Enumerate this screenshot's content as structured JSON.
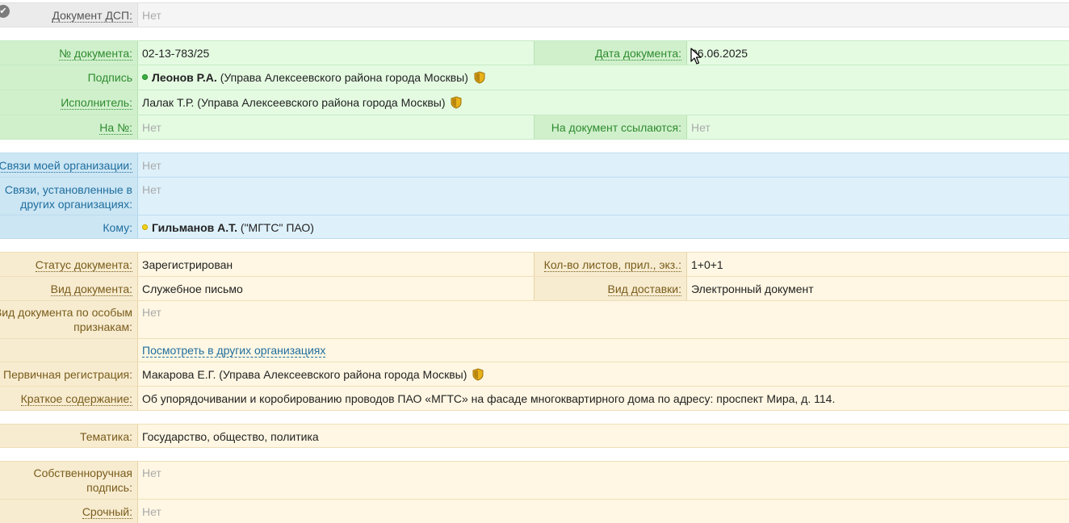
{
  "dsp": {
    "label": "Документ ДСП:",
    "value": "Нет"
  },
  "doc_number": {
    "label": "№ документа:",
    "value": "02-13-783/25"
  },
  "doc_date": {
    "label": "Дата документа:",
    "value": "06.06.2025"
  },
  "signature": {
    "label": "Подпись",
    "name": "Леонов Р.А.",
    "org": "(Управа Алексеевского района города Москвы)"
  },
  "executor": {
    "label": "Исполнитель:",
    "value": "Лалак Т.Р. (Управа Алексеевского района города Москвы)"
  },
  "in_reply": {
    "label": "На №:",
    "value": "Нет"
  },
  "referenced_by": {
    "label": "На документ ссылаются:",
    "value": "Нет"
  },
  "my_org_links": {
    "label": "Связи моей организации:",
    "value": "Нет"
  },
  "other_org_links": {
    "label_line1": "Связи, установленные в",
    "label_line2": "других организациях:",
    "value": "Нет"
  },
  "recipient": {
    "label": "Кому:",
    "name": "Гильманов А.Т.",
    "org": "(\"МГТС\" ПАО)"
  },
  "status": {
    "label": "Статус документа:",
    "value": "Зарегистрирован"
  },
  "sheets": {
    "label": "Кол-во листов, прил., экз.:",
    "value": "1+0+1"
  },
  "doc_type": {
    "label": "Вид документа:",
    "value": "Служебное письмо"
  },
  "delivery": {
    "label": "Вид доставки:",
    "value": "Электронный документ"
  },
  "special_type": {
    "label_line1": "Вид документа по особым",
    "label_line2": "признакам:",
    "value": "Нет"
  },
  "view_other_orgs": {
    "label": "Посмотреть в других организациях"
  },
  "primary_reg": {
    "label": "Первичная регистрация:",
    "value": "Макарова Е.Г. (Управа Алексеевского района города Москвы)"
  },
  "summary": {
    "label": "Краткое содержание:",
    "value": "Об упорядочивании и коробированию проводов ПАО «МГТС» на фасаде многоквартирного дома по адресу: проспект Мира, д. 114."
  },
  "topic": {
    "label": "Тематика:",
    "value": "Государство, общество, политика"
  },
  "handwritten": {
    "label_line1": "Собственноручная",
    "label_line2": "подпись:",
    "value": "Нет"
  },
  "urgent": {
    "label": "Срочный:",
    "value": "Нет"
  }
}
